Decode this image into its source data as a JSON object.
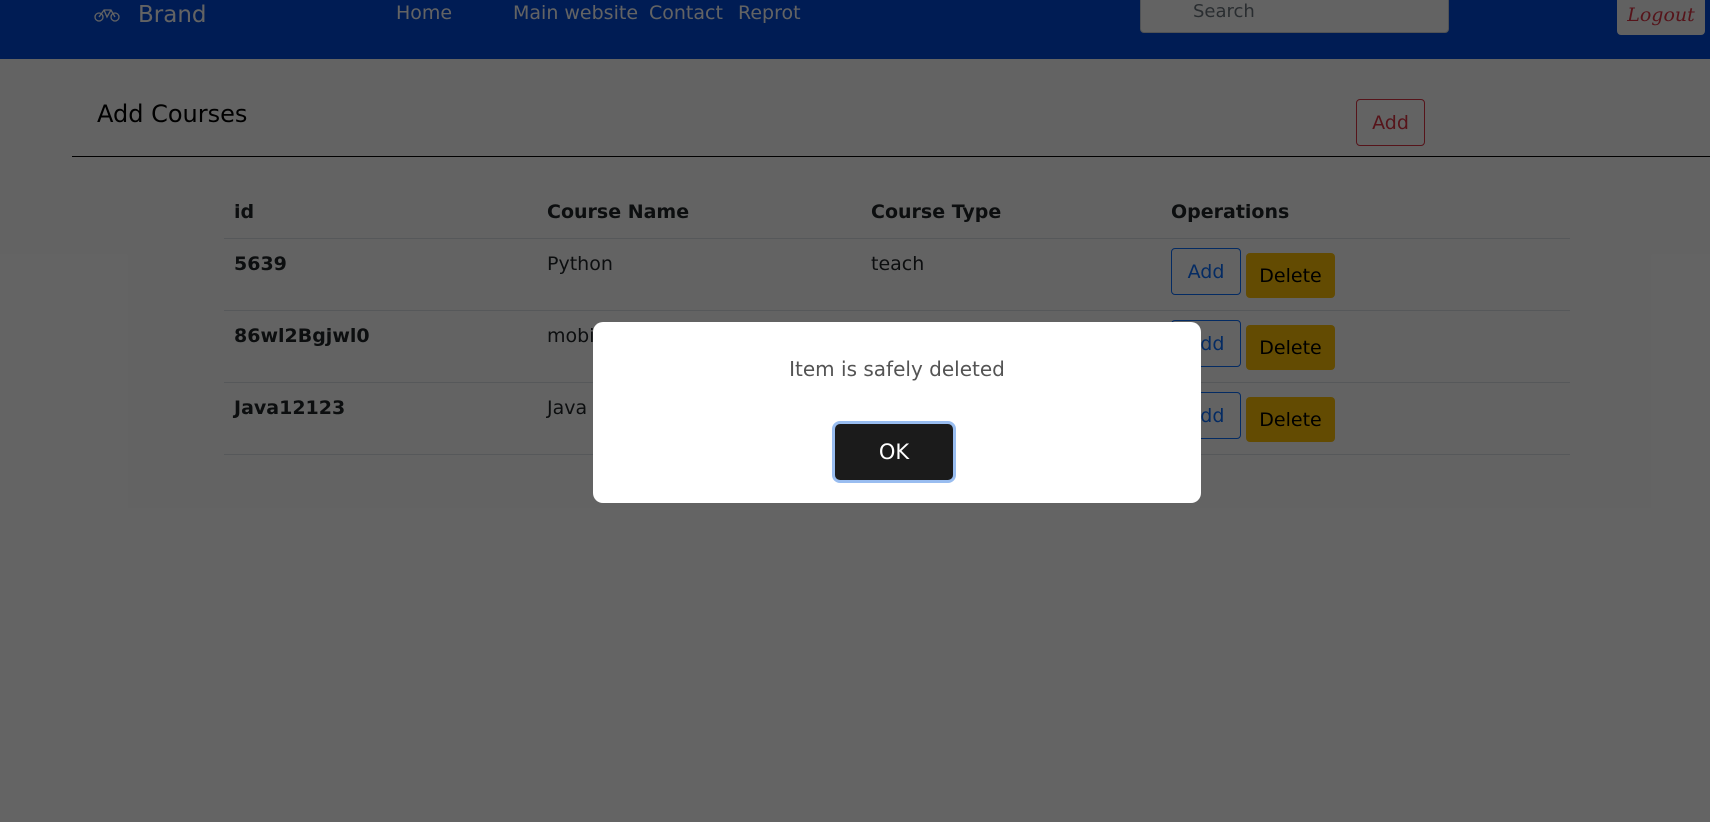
{
  "navbar": {
    "brand": "Brand",
    "brand_icon": "bicycle-icon",
    "links": [
      "Home",
      "Main website",
      "Contact",
      "Reprot"
    ],
    "search_placeholder": "Search",
    "logout": "Logout"
  },
  "section": {
    "title": "Add Courses",
    "add_label": "Add"
  },
  "table": {
    "headers": [
      "id",
      "Course Name",
      "Course Type",
      "Operations"
    ],
    "rows": [
      {
        "id": "5639",
        "name": "Python",
        "type": "teach"
      },
      {
        "id": "86wl2Bgjwl0",
        "name": "mobi",
        "type": ""
      },
      {
        "id": "Java12123",
        "name": "Java",
        "type": ""
      }
    ],
    "add_label": "Add",
    "delete_label": "Delete"
  },
  "dialog": {
    "message": "Item is safely deleted",
    "ok": "OK"
  },
  "colors": {
    "navbar": "#0048d8",
    "danger": "#dc3545",
    "primary": "#0d6efd",
    "warning": "#ffc107"
  }
}
